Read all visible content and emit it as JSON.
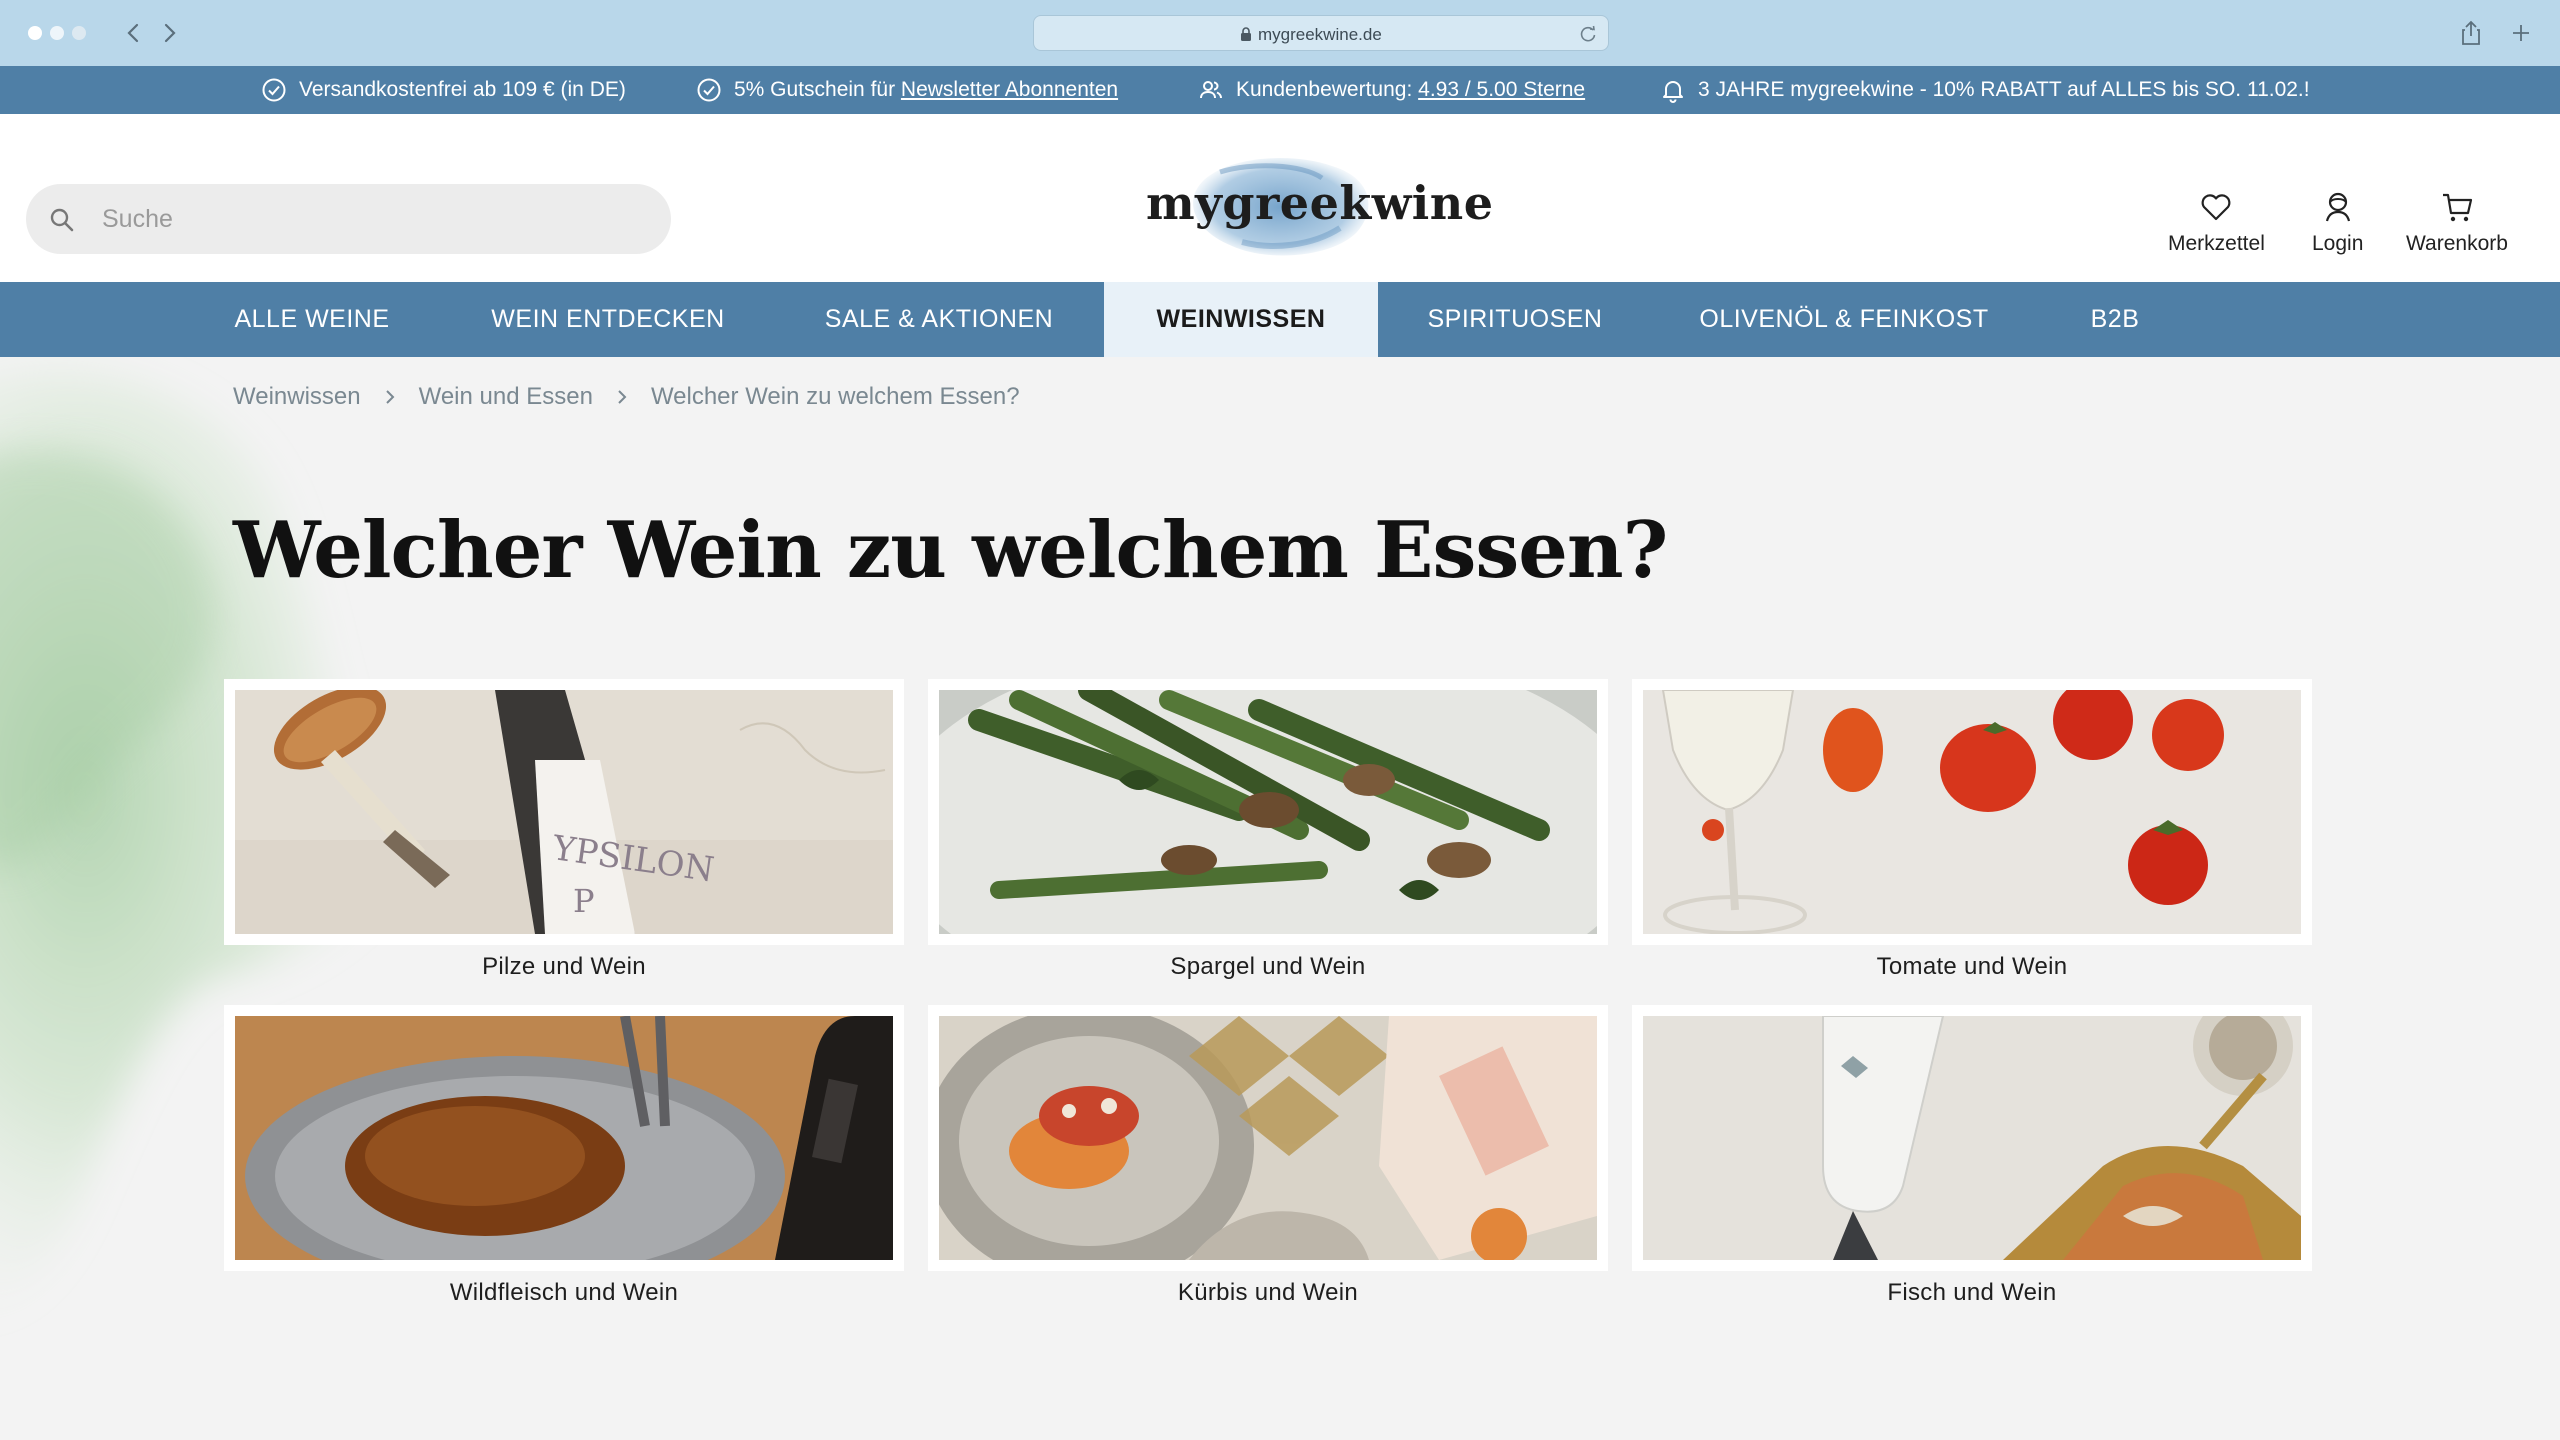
{
  "browser": {
    "url": "mygreekwine.de"
  },
  "infobar": {
    "shipping": "Versandkostenfrei ab 109 € (in DE)",
    "voucher_prefix": "5% Gutschein für ",
    "voucher_link": "Newsletter Abonnenten",
    "rating_prefix": "Kundenbewertung: ",
    "rating_link": "4.93 / 5.00 Sterne",
    "promo": "3 JAHRE mygreekwine - 10% RABATT auf ALLES bis SO. 11.02.!"
  },
  "header": {
    "search_placeholder": "Suche",
    "logo": "mygreekwine",
    "wishlist_label": "Merkzettel",
    "login_label": "Login",
    "cart_label": "Warenkorb"
  },
  "nav": {
    "items": [
      {
        "label": "ALLE WEINE"
      },
      {
        "label": "WEIN ENTDECKEN"
      },
      {
        "label": "SALE & AKTIONEN"
      },
      {
        "label": "WEINWISSEN"
      },
      {
        "label": "SPIRITUOSEN"
      },
      {
        "label": "OLIVENÖL & FEINKOST"
      },
      {
        "label": "B2B"
      }
    ],
    "active": "WEINWISSEN"
  },
  "breadcrumb": [
    {
      "label": "Weinwissen"
    },
    {
      "label": "Wein und Essen"
    },
    {
      "label": "Welcher Wein zu welchem Essen?"
    }
  ],
  "page": {
    "title": "Welcher Wein zu welchem Essen?"
  },
  "cards": [
    {
      "caption": "Pilze und Wein",
      "bottle_label": "YPSILON",
      "image": "mushroom-and-wine-bottle"
    },
    {
      "caption": "Spargel und Wein",
      "image": "asparagus-plate"
    },
    {
      "caption": "Tomate und Wein",
      "image": "tomatoes-and-wine-glass"
    },
    {
      "caption": "Wildfleisch und Wein",
      "image": "roasted-game-in-pan"
    },
    {
      "caption": "Kürbis und Wein",
      "image": "pumpkin-dish-with-bottle"
    },
    {
      "caption": "Fisch und Wein",
      "image": "fish-and-wine-bottle"
    }
  ],
  "colors": {
    "chrome": "#b9d7ea",
    "brand_blue": "#4f7fa6",
    "active_nav_bg": "#e8f1f8",
    "page_bg": "#f3f3f3"
  }
}
